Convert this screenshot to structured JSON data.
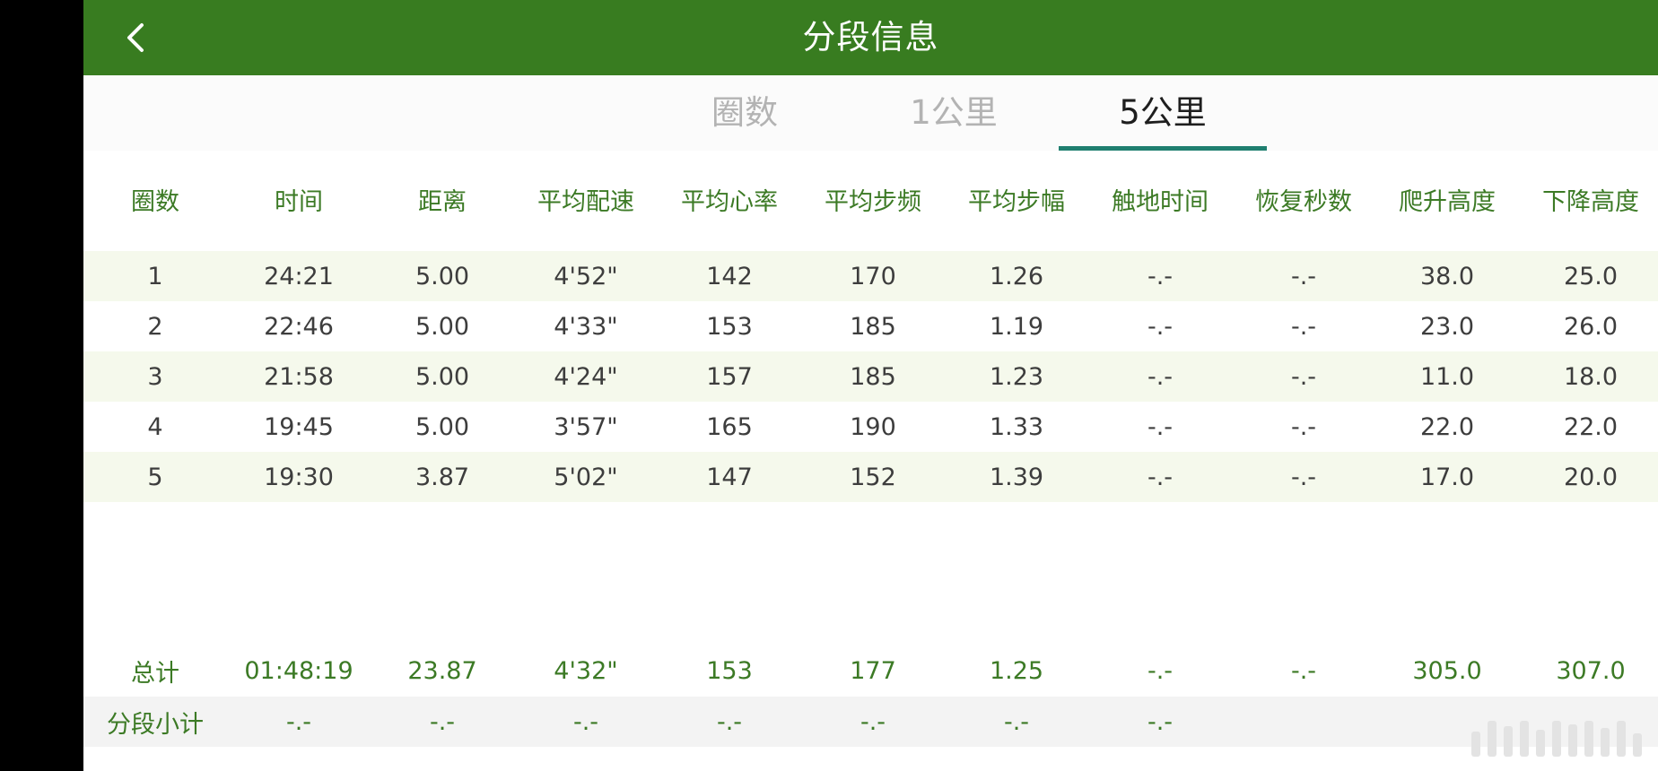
{
  "header": {
    "title": "分段信息",
    "back_icon": "chevron-left-icon"
  },
  "tabs": [
    {
      "label": "圈数",
      "active": false
    },
    {
      "label": "1公里",
      "active": false
    },
    {
      "label": "5公里",
      "active": true
    }
  ],
  "colors": {
    "header_bg": "#387c20",
    "accent": "#1f7f70",
    "green_text": "#3c7a25",
    "row_shade": "#f5f9ec"
  },
  "table": {
    "columns": [
      "圈数",
      "时间",
      "距离",
      "平均配速",
      "平均心率",
      "平均步频",
      "平均步幅",
      "触地时间",
      "恢复秒数",
      "爬升高度",
      "下降高度"
    ],
    "rows": [
      [
        "1",
        "24:21",
        "5.00",
        "4'52\"",
        "142",
        "170",
        "1.26",
        "-.-",
        "-.-",
        "38.0",
        "25.0"
      ],
      [
        "2",
        "22:46",
        "5.00",
        "4'33\"",
        "153",
        "185",
        "1.19",
        "-.-",
        "-.-",
        "23.0",
        "26.0"
      ],
      [
        "3",
        "21:58",
        "5.00",
        "4'24\"",
        "157",
        "185",
        "1.23",
        "-.-",
        "-.-",
        "11.0",
        "18.0"
      ],
      [
        "4",
        "19:45",
        "5.00",
        "3'57\"",
        "165",
        "190",
        "1.33",
        "-.-",
        "-.-",
        "22.0",
        "22.0"
      ],
      [
        "5",
        "19:30",
        "3.87",
        "5'02\"",
        "147",
        "152",
        "1.39",
        "-.-",
        "-.-",
        "17.0",
        "20.0"
      ]
    ],
    "total": [
      "总计",
      "01:48:19",
      "23.87",
      "4'32\"",
      "153",
      "177",
      "1.25",
      "-.-",
      "-.-",
      "305.0",
      "307.0"
    ],
    "subtotal": [
      "分段小计",
      "-.-",
      "-.-",
      "-.-",
      "-.-",
      "-.-",
      "-.-",
      "-.-"
    ]
  }
}
